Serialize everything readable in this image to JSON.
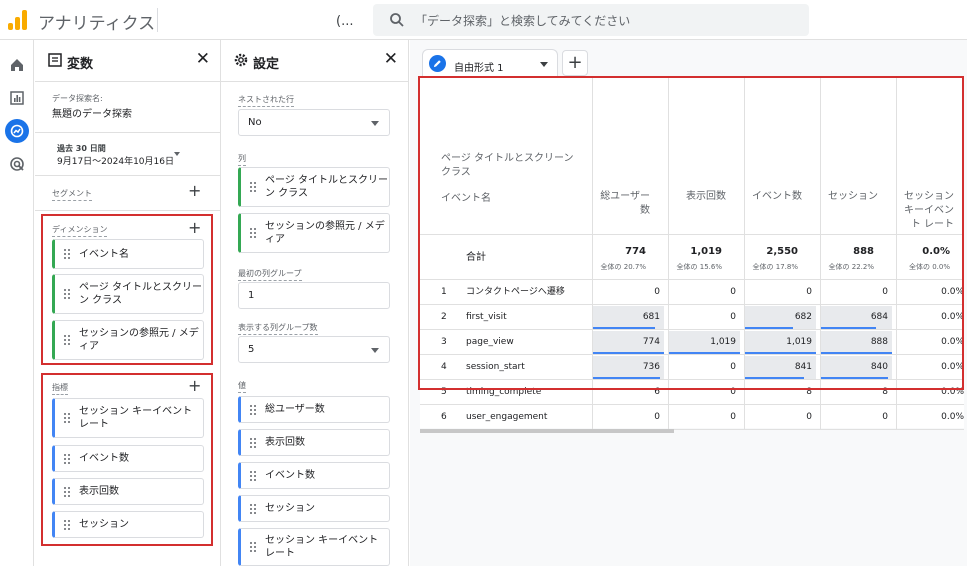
{
  "app": {
    "title": "アナリティクス",
    "ellipsis": "(...",
    "search_placeholder": "「データ探索」と検索してみてください"
  },
  "rail": [
    "home-icon",
    "reports-icon",
    "explore-icon",
    "advertising-icon"
  ],
  "variables": {
    "title": "変数",
    "name_label": "データ探索名:",
    "name_value": "無題のデータ探索",
    "date_label": "過去 30 日間",
    "date_range": "9月17日～2024年10月16日",
    "segments_label": "セグメント",
    "dimensions_label": "ディメンション",
    "dimensions": [
      "イベント名",
      "ページ タイトルとスクリーン クラス",
      "セッションの参照元 / メディア"
    ],
    "metrics_label": "指標",
    "metrics": [
      "セッション キーイベント レート",
      "イベント数",
      "表示回数",
      "セッション"
    ]
  },
  "settings": {
    "title": "設定",
    "nested_rows_label": "ネストされた行",
    "nested_rows_value": "No",
    "columns_label": "列",
    "columns": [
      "ページ タイトルとスクリーン クラス",
      "セッションの参照元 / メディア"
    ],
    "first_col_group_label": "最初の列グループ",
    "first_col_group_value": "1",
    "show_col_groups_label": "表示する列グループ数",
    "show_col_groups_value": "5",
    "values_label": "値",
    "values": [
      "総ユーザー数",
      "表示回数",
      "イベント数",
      "セッション",
      "セッション キーイベント レート"
    ]
  },
  "tab": {
    "label": "自由形式 1",
    "add_label": "+"
  },
  "table": {
    "col_dim_header": "ページ タイトルとスクリーン クラス",
    "row_dim_header": "イベント名",
    "metric_headers": [
      "総ユーザー数",
      "表示回数",
      "イベント数",
      "セッション",
      "セッション キーイベント レート"
    ],
    "totals_label": "合計",
    "totals": [
      "774",
      "1,019",
      "2,550",
      "888",
      "0.0%"
    ],
    "totals_sub": [
      "全体の 20.7%",
      "全体の 15.6%",
      "全体の 17.8%",
      "全体の 22.2%",
      "全体の 0.0%"
    ],
    "rows": [
      {
        "idx": "1",
        "name": "コンタクトページへ遷移",
        "vals": [
          "0",
          "0",
          "0",
          "0",
          "0.0%"
        ]
      },
      {
        "idx": "2",
        "name": "first_visit",
        "vals": [
          "681",
          "0",
          "682",
          "684",
          "0.0%"
        ]
      },
      {
        "idx": "3",
        "name": "page_view",
        "vals": [
          "774",
          "1,019",
          "1,019",
          "888",
          "0.0%"
        ]
      },
      {
        "idx": "4",
        "name": "session_start",
        "vals": [
          "736",
          "0",
          "841",
          "840",
          "0.0%"
        ]
      },
      {
        "idx": "5",
        "name": "timing_complete",
        "vals": [
          "6",
          "0",
          "8",
          "8",
          "0.0%"
        ]
      },
      {
        "idx": "6",
        "name": "user_engagement",
        "vals": [
          "0",
          "0",
          "0",
          "0",
          "0.0%"
        ]
      }
    ],
    "heat_levels": [
      [
        0,
        0,
        0,
        0,
        0
      ],
      [
        0.88,
        0,
        0.67,
        0.77,
        0
      ],
      [
        1,
        1,
        1,
        1,
        0
      ],
      [
        0.95,
        0,
        0.83,
        0.95,
        0
      ],
      [
        0,
        0,
        0,
        0,
        0
      ],
      [
        0,
        0,
        0,
        0,
        0
      ]
    ]
  },
  "colors": {
    "accent": "#1a73e8",
    "highlight_border": "#d32f2f",
    "heat": "#e8eaed",
    "dim_chip": "#34a853",
    "metric_chip": "#4285f4"
  }
}
